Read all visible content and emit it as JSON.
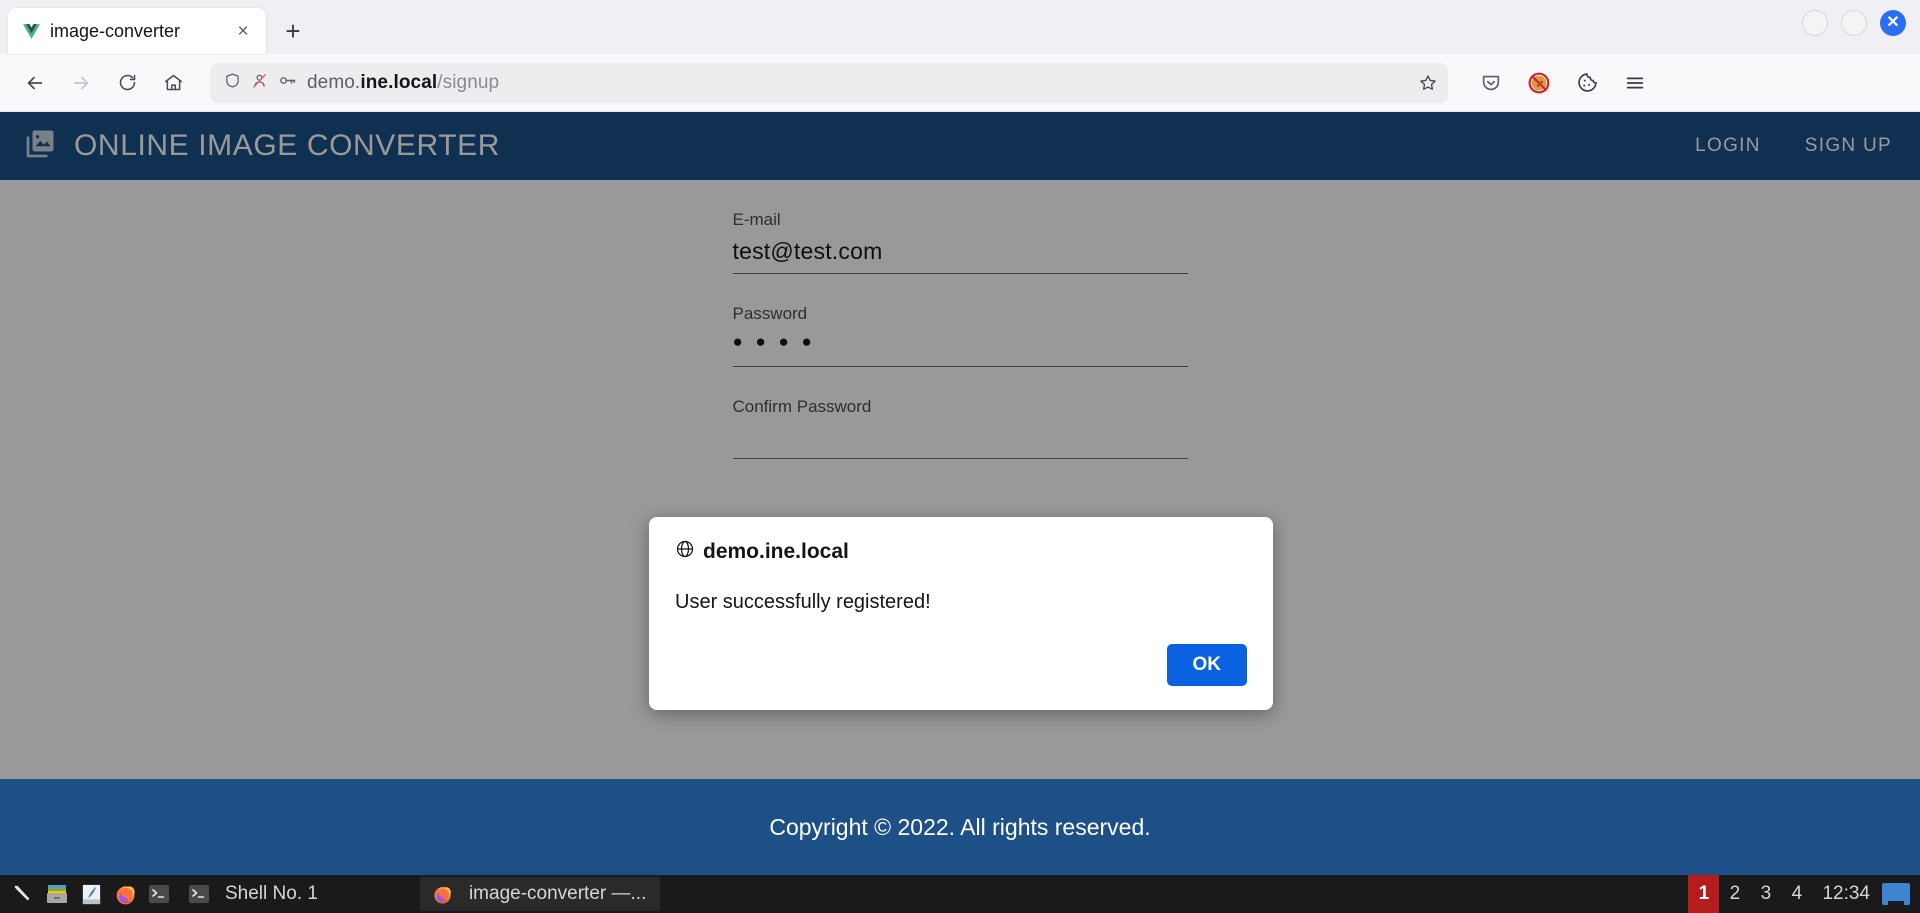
{
  "browser": {
    "tab": {
      "title": "image-converter",
      "favicon": "vue-logo-icon",
      "close_label": "×"
    },
    "newtab_label": "+",
    "window_controls": {
      "minimize": "minimize-button",
      "maximize": "maximize-button",
      "close": "✕"
    },
    "nav": {
      "back": "back-button",
      "forward": "forward-button",
      "reload": "reload-button",
      "home": "home-button"
    },
    "url": {
      "prefix": "demo.",
      "host": "ine.local",
      "path": "/signup",
      "full": "demo.ine.local/signup",
      "icons": [
        "shield-icon",
        "tracker-blocked-icon",
        "key-icon"
      ],
      "bookmark": "star-icon"
    },
    "toolbar_right": [
      "pocket-icon",
      "cookie-blocked-icon",
      "cookie-icon",
      "menu-icon"
    ]
  },
  "site": {
    "header": {
      "logo": "image-library-icon",
      "title": "ONLINE IMAGE CONVERTER",
      "nav": [
        {
          "label": "LOGIN",
          "name": "nav-login"
        },
        {
          "label": "SIGN UP",
          "name": "nav-signup"
        }
      ]
    },
    "form": {
      "fields": [
        {
          "label": "E-mail",
          "value": "test@test.com",
          "name": "email"
        },
        {
          "label": "Password",
          "value": "● ● ● ●",
          "name": "password"
        },
        {
          "label": "Confirm Password",
          "value": "",
          "name": "confirm-password"
        }
      ]
    },
    "footer": {
      "text": "Copyright © 2022. All rights reserved."
    }
  },
  "dialog": {
    "icon": "globe-icon",
    "origin": "demo.ine.local",
    "message": "User successfully registered!",
    "ok_label": "OK"
  },
  "taskbar": {
    "launchers": [
      "tools-icon",
      "file-manager-icon",
      "text-editor-icon",
      "firefox-icon",
      "terminal-icon"
    ],
    "windows": [
      {
        "label": "Shell No. 1",
        "icon": "terminal-icon",
        "active": false
      },
      {
        "label": "image-converter —...",
        "icon": "firefox-icon",
        "active": true
      }
    ],
    "workspaces": [
      "1",
      "2",
      "3",
      "4"
    ],
    "active_workspace": "1",
    "clock": "12:34",
    "show_desktop": "show-desktop-icon"
  },
  "colors": {
    "site_blue": "#1c5087",
    "dialog_button_blue": "#0a62e0",
    "workspace_active_red": "#b51c1c",
    "close_button_blue": "#2b6ef5"
  }
}
